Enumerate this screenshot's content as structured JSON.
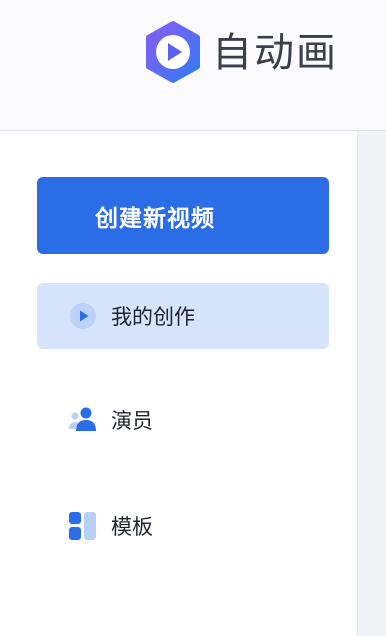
{
  "brand": {
    "name": "自动画",
    "logo_icon": "play-logo-icon"
  },
  "sidebar": {
    "create_button": "创建新视频",
    "items": [
      {
        "label": "我的创作",
        "icon": "play-circle-icon",
        "active": true
      },
      {
        "label": "演员",
        "icon": "users-icon",
        "active": false
      },
      {
        "label": "模板",
        "icon": "template-grid-icon",
        "active": false
      }
    ]
  },
  "colors": {
    "accent": "#2b6de6",
    "active_bg": "#d6e4fb",
    "logo_purple": "#7b4df2",
    "logo_blue": "#2f7bf3"
  }
}
